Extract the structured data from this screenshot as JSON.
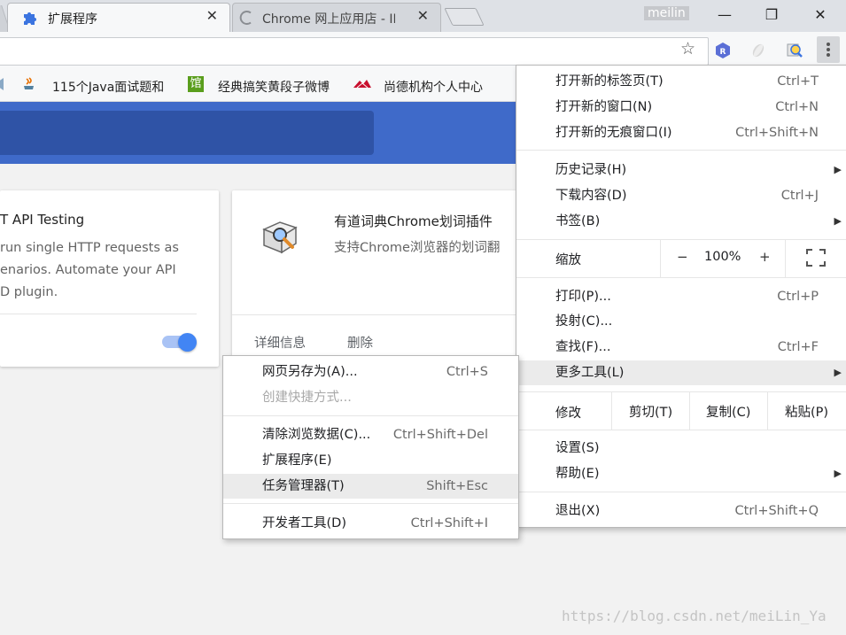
{
  "tabs": [
    {
      "title": "扩展程序",
      "active": true
    },
    {
      "title": "Chrome 网上应用店 - IE",
      "active": false
    }
  ],
  "profile_name": "meilin",
  "window_controls": {
    "minimize": "—",
    "maximize": "❐",
    "close": "✕"
  },
  "bookmarks": [
    {
      "label": "115个Java面试题和",
      "icon": "java-icon"
    },
    {
      "label": "经典搞笑黄段子微博",
      "icon": "guan-icon",
      "icon_text": "馆"
    },
    {
      "label": "尚德机构个人中心",
      "icon": "sunlands-icon"
    }
  ],
  "cards": {
    "rest": {
      "name": "T API Testing",
      "description": "run single HTTP requests as\nenarios. Automate your API\nD plugin."
    },
    "youdao": {
      "name": "有道词典Chrome划词插件",
      "description": "支持Chrome浏览器的划词翻",
      "details_link": "详细信息",
      "remove_link": "删除"
    }
  },
  "main_menu": {
    "new_tab": {
      "label": "打开新的标签页(T)",
      "shortcut": "Ctrl+T"
    },
    "new_window": {
      "label": "打开新的窗口(N)",
      "shortcut": "Ctrl+N"
    },
    "new_incognito": {
      "label": "打开新的无痕窗口(I)",
      "shortcut": "Ctrl+Shift+N"
    },
    "history": {
      "label": "历史记录(H)"
    },
    "downloads": {
      "label": "下载内容(D)",
      "shortcut": "Ctrl+J"
    },
    "bookmarks": {
      "label": "书签(B)"
    },
    "zoom": {
      "label": "缩放",
      "minus": "−",
      "value": "100%",
      "plus": "+"
    },
    "print": {
      "label": "打印(P)...",
      "shortcut": "Ctrl+P"
    },
    "cast": {
      "label": "投射(C)..."
    },
    "find": {
      "label": "查找(F)...",
      "shortcut": "Ctrl+F"
    },
    "more_tools": {
      "label": "更多工具(L)"
    },
    "edit": {
      "label": "修改",
      "cut": "剪切(T)",
      "copy": "复制(C)",
      "paste": "粘贴(P)"
    },
    "settings": {
      "label": "设置(S)"
    },
    "help": {
      "label": "帮助(E)"
    },
    "exit": {
      "label": "退出(X)",
      "shortcut": "Ctrl+Shift+Q"
    }
  },
  "more_tools_menu": {
    "save_page": {
      "label": "网页另存为(A)...",
      "shortcut": "Ctrl+S"
    },
    "create_shortcut": {
      "label": "创建快捷方式..."
    },
    "clear_data": {
      "label": "清除浏览数据(C)...",
      "shortcut": "Ctrl+Shift+Del"
    },
    "extensions": {
      "label": "扩展程序(E)"
    },
    "task_manager": {
      "label": "任务管理器(T)",
      "shortcut": "Shift+Esc"
    },
    "dev_tools": {
      "label": "开发者工具(D)",
      "shortcut": "Ctrl+Shift+I"
    }
  },
  "watermark": "https://blog.csdn.net/meiLin_Ya",
  "colors": {
    "header_blue": "#3f6ac9",
    "toggle_blue": "#4285f4"
  }
}
